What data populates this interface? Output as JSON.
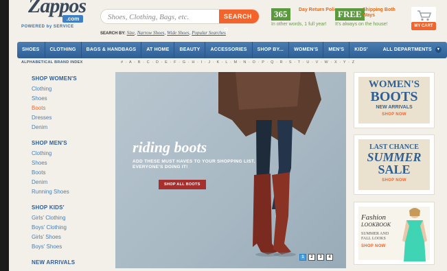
{
  "header": {
    "logo_word": "Zappos",
    "logo_com": ".com",
    "logo_tagline": "POWERED by SERVICE",
    "search_placeholder": "Shoes, Clothing, Bags, etc.",
    "search_button": "SEARCH",
    "search_by_label": "SEARCH BY:",
    "search_by_links": [
      "Size",
      "Narrow Shoes",
      "Wide Shoes",
      "Popular Searches"
    ],
    "promo_365_badge": "365",
    "promo_365_title": "Day Return Policy",
    "promo_365_sub": "In other words, 1 full year!",
    "promo_free_badge": "FREE",
    "promo_free_title": "Shipping Both Ways",
    "promo_free_sub": "It's always on the house!",
    "cart_label": "MY CART"
  },
  "nav": {
    "items": [
      "SHOES",
      "CLOTHING",
      "BAGS & HANDBAGS",
      "AT HOME",
      "BEAUTY",
      "ACCESSORIES",
      "SHOP BY...",
      "WOMEN'S",
      "MEN'S",
      "KIDS'"
    ],
    "all_departments": "ALL DEPARTMENTS"
  },
  "alpha_index": {
    "label": "ALPHABETICAL BRAND INDEX",
    "letters": "# · A · B · C · D · E · F · G · H · I · J · K · L · M · N · O · P · Q · R · S · T · U · V · W · X · Y · Z"
  },
  "sidebar": {
    "women": {
      "title": "SHOP WOMEN'S",
      "links": [
        "Clothing",
        "Shoes",
        "Boots",
        "Dresses",
        "Denim"
      ],
      "active_index": 2
    },
    "men": {
      "title": "SHOP MEN'S",
      "links": [
        "Clothing",
        "Shoes",
        "Boots",
        "Denim",
        "Running Shoes"
      ]
    },
    "kids": {
      "title": "SHOP KIDS'",
      "links": [
        "Girls' Clothing",
        "Boys' Clothing",
        "Girls' Shoes",
        "Boys' Shoes"
      ]
    },
    "new_arrivals": {
      "title": "NEW ARRIVALS"
    }
  },
  "hero": {
    "title": "riding boots",
    "subtitle": "ADD THESE MUST HAVES TO YOUR SHOPPING LIST. EVERYONE'S DOING IT!",
    "cta": "SHOP ALL BOOTS",
    "pages": [
      "1",
      "2",
      "3",
      "4"
    ],
    "active_page": 1
  },
  "promos": {
    "p1": {
      "line1": "WOMEN'S",
      "line2": "BOOTS",
      "line3": "NEW ARRIVALS",
      "cta": "SHOP NOW"
    },
    "p2": {
      "line1": "LAST CHANCE",
      "line2": "SUMMER",
      "line3": "SALE",
      "cta": "SHOP NOW"
    },
    "p3": {
      "line1": "Fashion",
      "line2": "LOOKBOOK",
      "line3": "SUMMER AND FALL LOOKS",
      "cta": "SHOP NOW"
    }
  },
  "colors": {
    "accent": "#f2642b",
    "nav_blue": "#3a6aa0",
    "link_blue": "#4a7db3",
    "background": "#f2f0e8"
  }
}
